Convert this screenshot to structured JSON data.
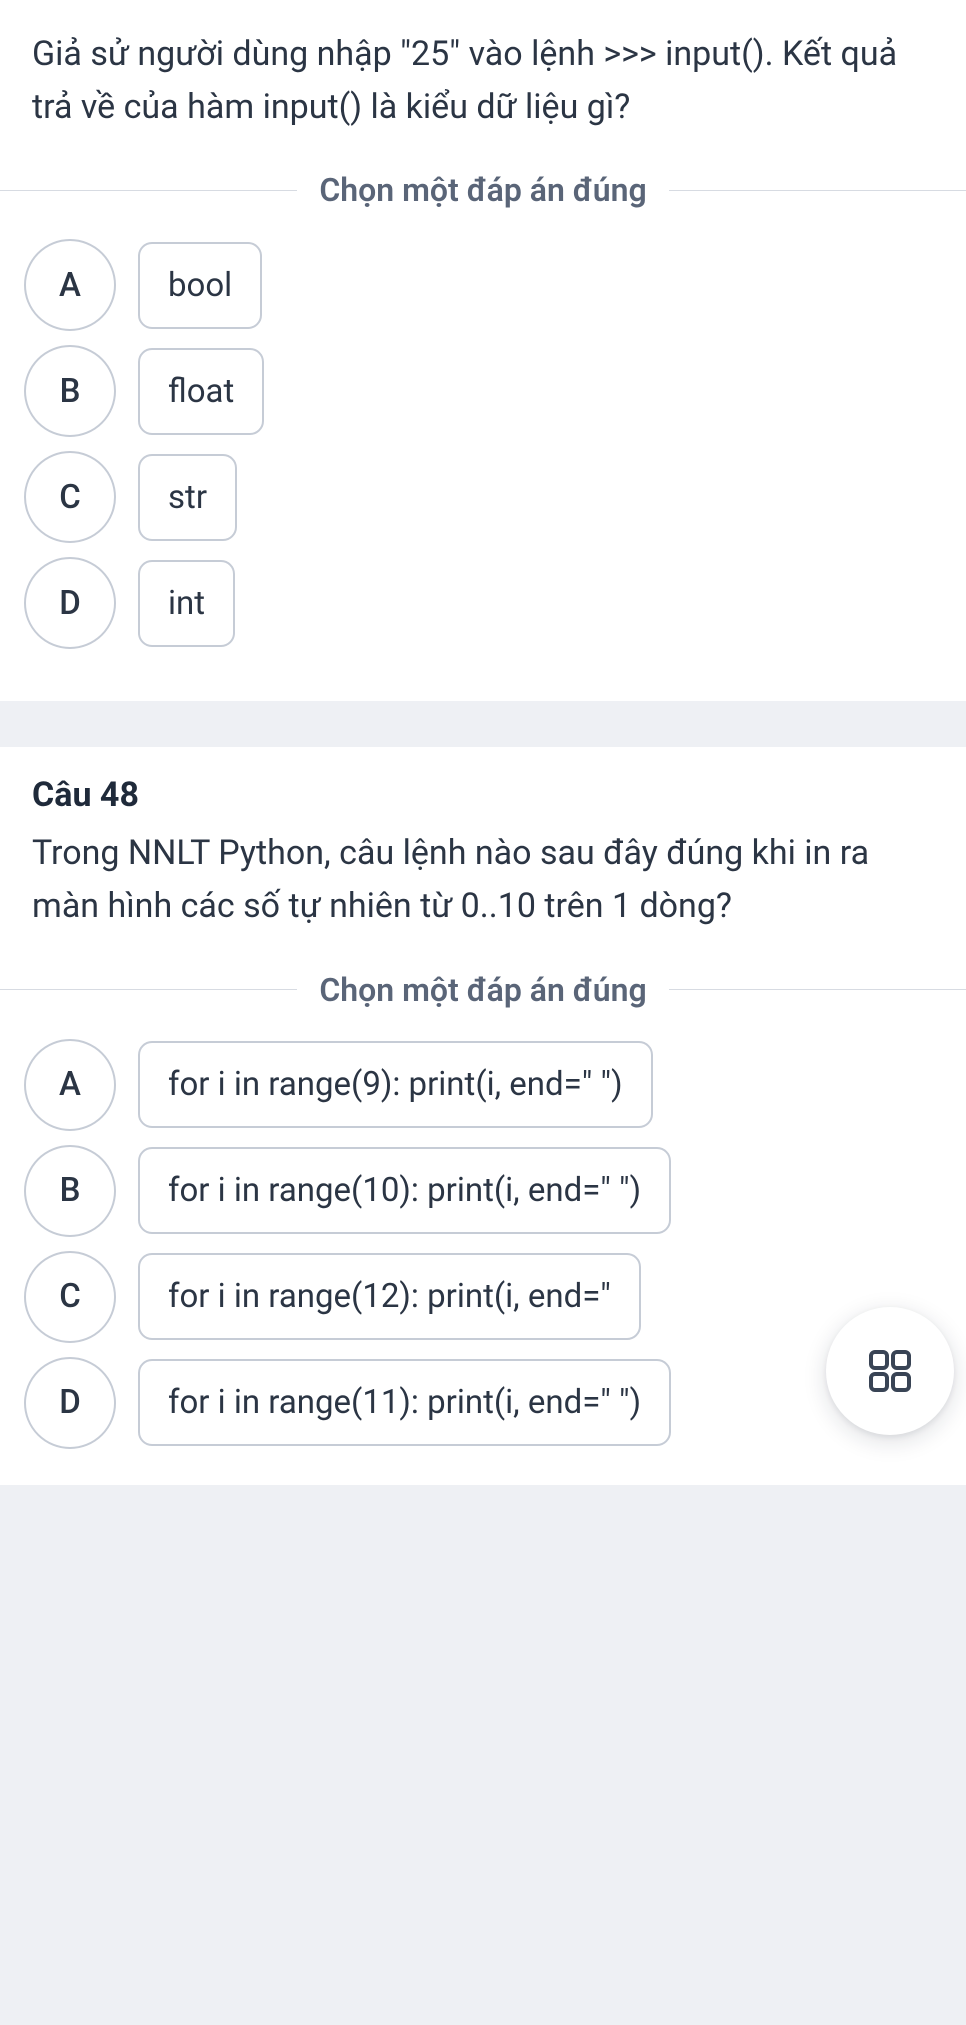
{
  "q1": {
    "text": "Giả sử người dùng nhập \"25\" vào lệnh >>> input(). Kết quả trả về của hàm input() là kiểu dữ liệu gì?",
    "instruction": "Chọn một đáp án đúng",
    "options": {
      "A": {
        "letter": "A",
        "label": "bool"
      },
      "B": {
        "letter": "B",
        "label": "float"
      },
      "C": {
        "letter": "C",
        "label": "str"
      },
      "D": {
        "letter": "D",
        "label": "int"
      }
    }
  },
  "q2": {
    "title": "Câu 48",
    "text": "Trong NNLT Python, câu lệnh nào sau đây đúng khi in ra màn hình các số tự nhiên từ 0..10 trên 1 dòng?",
    "instruction": "Chọn một đáp án đúng",
    "options": {
      "A": {
        "letter": "A",
        "label": "for i in range(9): print(i, end=\" \")"
      },
      "B": {
        "letter": "B",
        "label": "for i in range(10): print(i, end=\" \")"
      },
      "C": {
        "letter": "C",
        "label": "for i in range(12): print(i, end=\""
      },
      "D": {
        "letter": "D",
        "label": "for i in range(11): print(i, end=\" \")"
      }
    }
  }
}
